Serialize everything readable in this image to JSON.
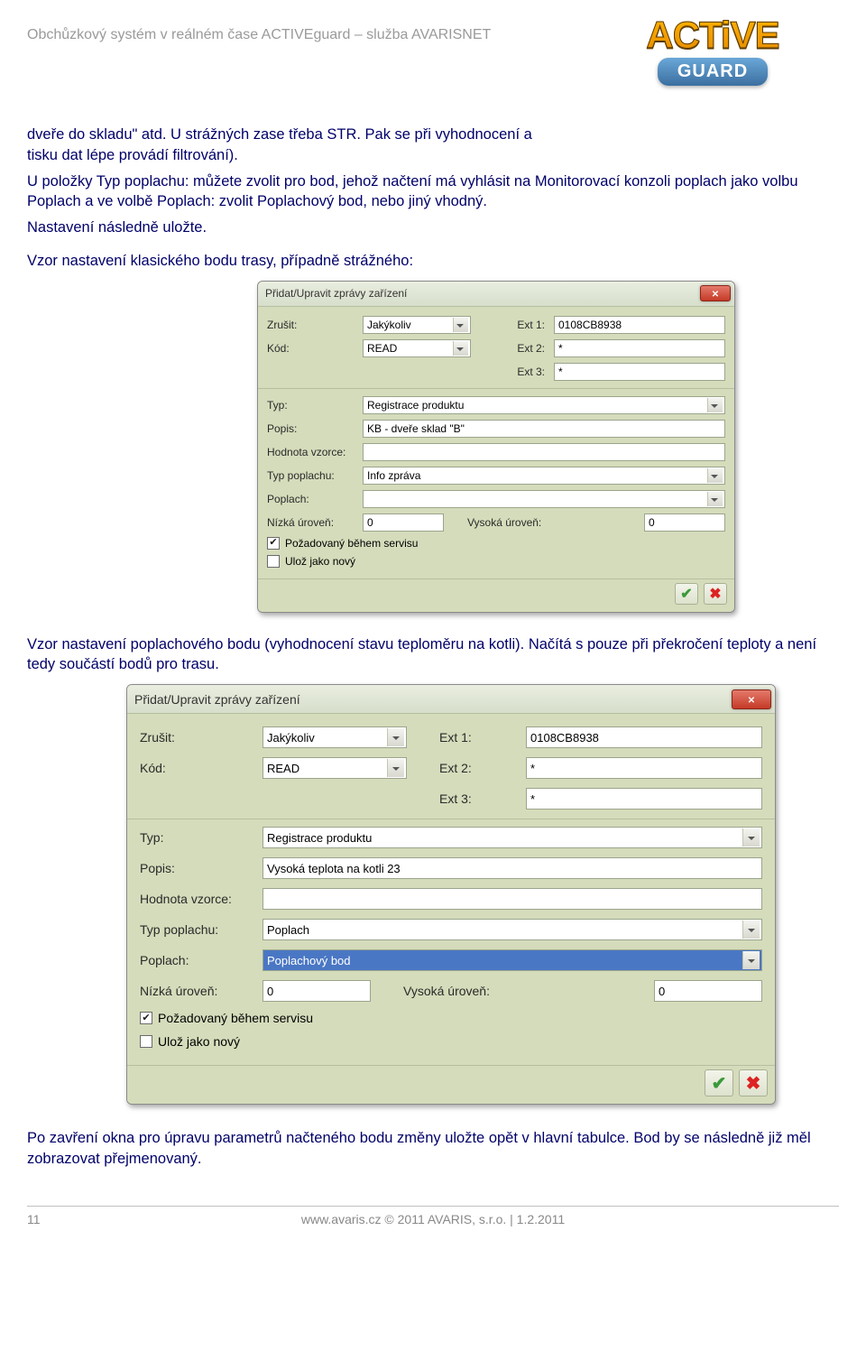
{
  "header": {
    "text": "Obchůzkový systém v reálném čase ACTIVEguard – služba AVARISNET",
    "logo_top": "ACTiVE",
    "logo_bottom": "GUARD"
  },
  "para1_narrow": "dveře do skladu\" atd. U strážných zase třeba STR. Pak se při vyhodnocení a tisku dat lépe provádí filtrování).",
  "para2": "U položky Typ poplachu: můžete zvolit pro bod, jehož načtení má vyhlásit na Monitorovací konzoli poplach jako volbu Poplach a ve volbě Poplach: zvolit Poplachový bod, nebo jiný vhodný.",
  "para3": "Nastavení následně uložte.",
  "para4": "Vzor nastavení klasického bodu trasy, případně strážného:",
  "para5": "Vzor nastavení poplachového bodu (vyhodnocení stavu teploměru na kotli). Načítá s pouze při překročení teploty a není tedy součástí bodů pro trasu.",
  "para6": "Po zavření okna pro úpravu parametrů načteného bodu změny uložte opět v hlavní tabulce. Bod by se následně již měl zobrazovat přejmenovaný.",
  "dlg_title": "Přidat/Upravit zprávy zařízení",
  "labels": {
    "zrusit": "Zrušit:",
    "kod": "Kód:",
    "ext1": "Ext 1:",
    "ext2": "Ext 2:",
    "ext3": "Ext 3:",
    "typ": "Typ:",
    "popis": "Popis:",
    "hodnota": "Hodnota vzorce:",
    "typ_poplachu": "Typ poplachu:",
    "poplach": "Poplach:",
    "nizka": "Nízká úroveň:",
    "vysoka": "Vysoká úroveň:",
    "pozadovany": "Požadovaný během servisu",
    "uloz_novy": "Ulož jako nový"
  },
  "dlg1": {
    "zrusit": "Jakýkoliv",
    "kod": "READ",
    "ext1": "0108CB8938",
    "ext2": "*",
    "ext3": "*",
    "typ": "Registrace produktu",
    "popis": "KB - dveře sklad \"B\"",
    "hodnota": "",
    "typ_poplachu": "Info zpráva",
    "poplach": "",
    "nizka": "0",
    "vysoka": "0",
    "pozadovany_checked": true,
    "uloz_novy_checked": false
  },
  "dlg2": {
    "zrusit": "Jakýkoliv",
    "kod": "READ",
    "ext1": "0108CB8938",
    "ext2": "*",
    "ext3": "*",
    "typ": "Registrace produktu",
    "popis": "Vysoká teplota na kotli 23",
    "hodnota": "",
    "typ_poplachu": "Poplach",
    "poplach": "Poplachový bod",
    "nizka": "0",
    "vysoka": "0",
    "pozadovany_checked": true,
    "uloz_novy_checked": false
  },
  "footer": {
    "page": "11",
    "center": "www.avaris.cz © 2011 AVARIS, s.r.o. | 1.2.2011"
  }
}
